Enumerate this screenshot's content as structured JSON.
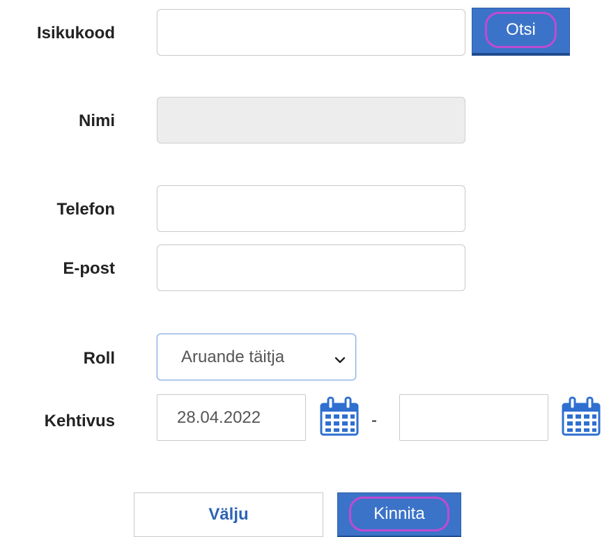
{
  "form": {
    "isikukood": {
      "label": "Isikukood",
      "value": ""
    },
    "search_button": {
      "label": "Otsi"
    },
    "nimi": {
      "label": "Nimi",
      "value": ""
    },
    "telefon": {
      "label": "Telefon",
      "value": ""
    },
    "epost": {
      "label": "E-post",
      "value": ""
    },
    "roll": {
      "label": "Roll",
      "selected": "Aruande täitja"
    },
    "kehtivus": {
      "label": "Kehtivus",
      "start_date": "28.04.2022",
      "separator": "-",
      "end_date": ""
    }
  },
  "actions": {
    "cancel_label": "Välju",
    "confirm_label": "Kinnita"
  },
  "icons": {
    "calendar": "calendar-icon",
    "dropdown": "chevron-down-icon"
  },
  "colors": {
    "primary_button": "#3b73c8",
    "highlight_ring": "#c04bd2",
    "link_text": "#2f63b6",
    "calendar_icon": "#2f6fd0"
  }
}
